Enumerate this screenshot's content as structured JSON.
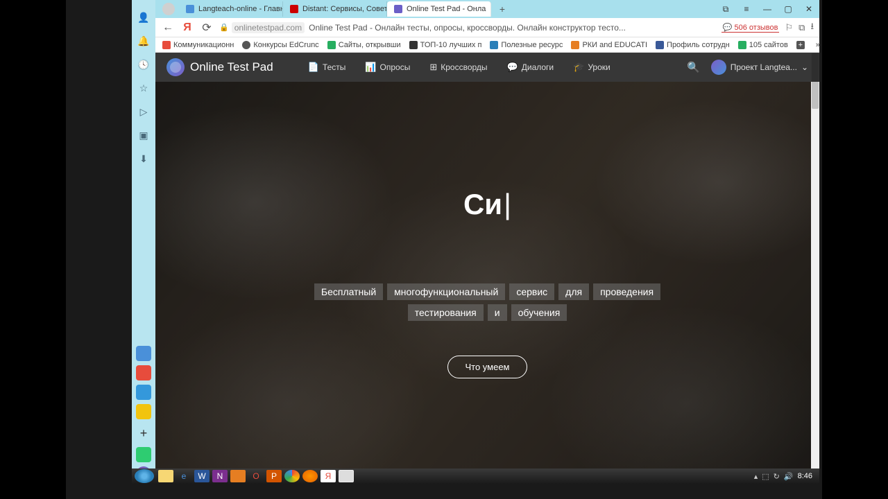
{
  "tabs": [
    {
      "label": "Langteach-online - Главна",
      "iconColor": "#4a90d9"
    },
    {
      "label": "Distant: Сервисы, Советы",
      "iconColor": "#cc0000"
    },
    {
      "label": "Online Test Pad - Онла",
      "iconColor": "#6b5fc7",
      "active": true
    }
  ],
  "address": {
    "domain": "onlinetestpad.com",
    "title": "Online Test Pad - Онлайн тесты, опросы, кроссворды. Онлайн конструктор тесто...",
    "reviews": "506 отзывов"
  },
  "bookmarks": [
    {
      "label": "Коммуникационн",
      "color": "#e74c3c"
    },
    {
      "label": "Конкурсы EdCrunc",
      "color": "#555"
    },
    {
      "label": "Сайты, открывши",
      "color": "#27ae60"
    },
    {
      "label": "ТОП-10 лучших п",
      "color": "#333"
    },
    {
      "label": "Полезные ресурс",
      "color": "#2a7fb8"
    },
    {
      "label": "РКИ and EDUCATI",
      "color": "#e67e22"
    },
    {
      "label": "Профиль сотрудн",
      "color": "#3a5998"
    },
    {
      "label": "105 сайтов",
      "color": "#27ae60"
    }
  ],
  "site": {
    "brand": "Online Test Pad",
    "nav": [
      {
        "label": "Тесты",
        "icon": "📄"
      },
      {
        "label": "Опросы",
        "icon": "📊"
      },
      {
        "label": "Кроссворды",
        "icon": "⊞"
      },
      {
        "label": "Диалоги",
        "icon": "💬"
      },
      {
        "label": "Уроки",
        "icon": "🎓"
      }
    ],
    "user": "Проект Langtea..."
  },
  "hero": {
    "title": "Си",
    "tags": [
      "Бесплатный",
      "многофункциональный",
      "сервис",
      "для",
      "проведения",
      "тестирования",
      "и",
      "обучения"
    ],
    "cta": "Что умеем"
  },
  "tray": {
    "time": "8:46"
  }
}
